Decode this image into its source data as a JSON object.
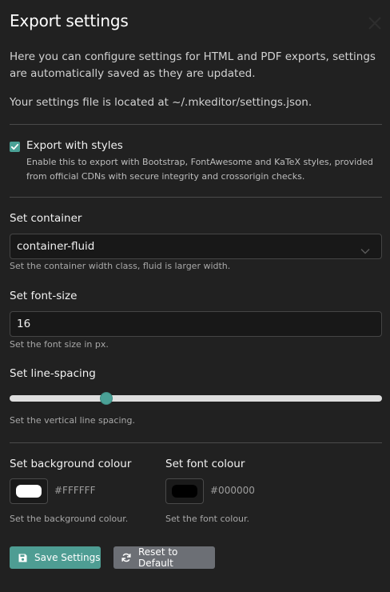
{
  "dialog": {
    "title": "Export settings",
    "intro": "Here you can configure settings for HTML and PDF exports, settings are automatically saved as they are updated.",
    "location": "Your settings file is located at ~/.mkeditor/settings.json."
  },
  "export_styles": {
    "checked": true,
    "label": "Export with styles",
    "help": "Enable this to export with Bootstrap, FontAwesome and KaTeX styles, provided from official CDNs with secure integrity and crossorigin checks."
  },
  "container": {
    "label": "Set container",
    "value": "container-fluid",
    "help": "Set the container width class, fluid is larger width."
  },
  "font_size": {
    "label": "Set font-size",
    "value": "16",
    "help": "Set the font size in px."
  },
  "line_spacing": {
    "label": "Set line-spacing",
    "level_fraction": 0.26,
    "help": "Set the vertical line spacing."
  },
  "background_colour": {
    "label": "Set background colour",
    "value": "#FFFFFF",
    "help": "Set the background colour."
  },
  "font_colour": {
    "label": "Set font colour",
    "value": "#000000",
    "help": "Set the font colour."
  },
  "buttons": {
    "save": "Save Settings",
    "reset": "Reset to Default"
  },
  "colors": {
    "accent": "#4aa196",
    "background": "#212121",
    "reset_button": "#6c6f75"
  }
}
